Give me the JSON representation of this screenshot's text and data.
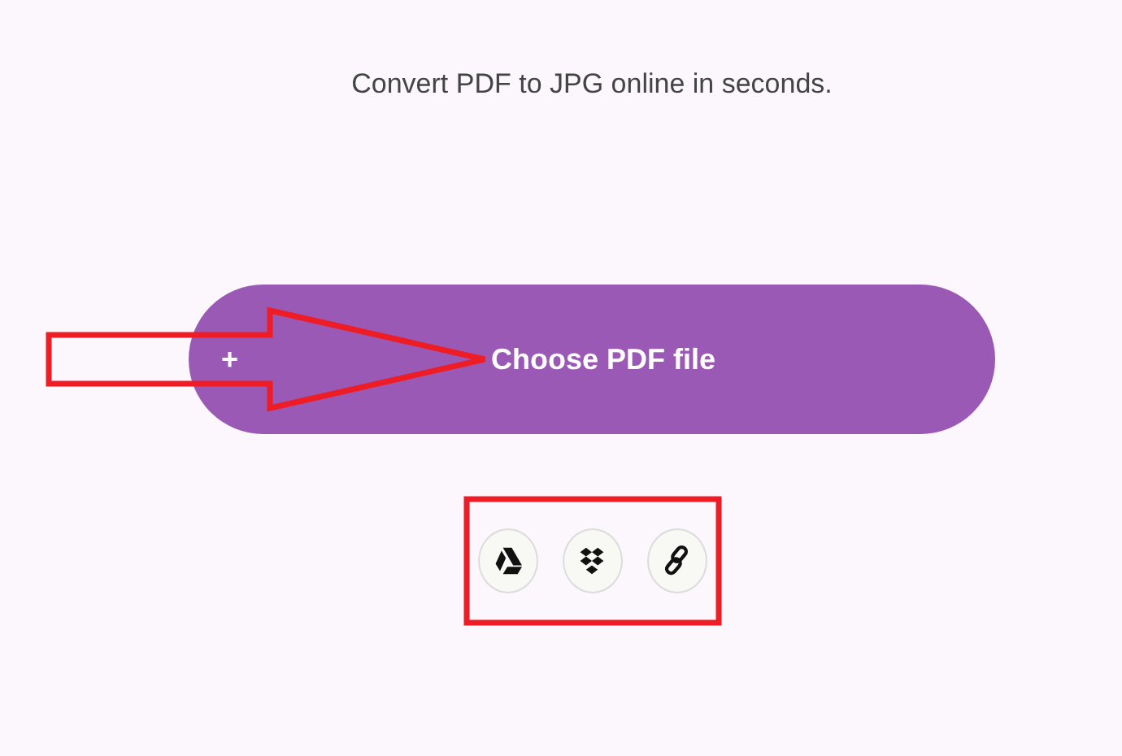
{
  "tagline": "Convert PDF to JPG online in seconds.",
  "upload_button": {
    "icon": "+",
    "label": "Choose PDF file",
    "annotation": {
      "kind": "arrow"
    }
  },
  "sources": {
    "annotation": {
      "kind": "box"
    },
    "items": [
      {
        "kind": "drive"
      },
      {
        "kind": "dropbox"
      },
      {
        "kind": "link"
      }
    ]
  }
}
